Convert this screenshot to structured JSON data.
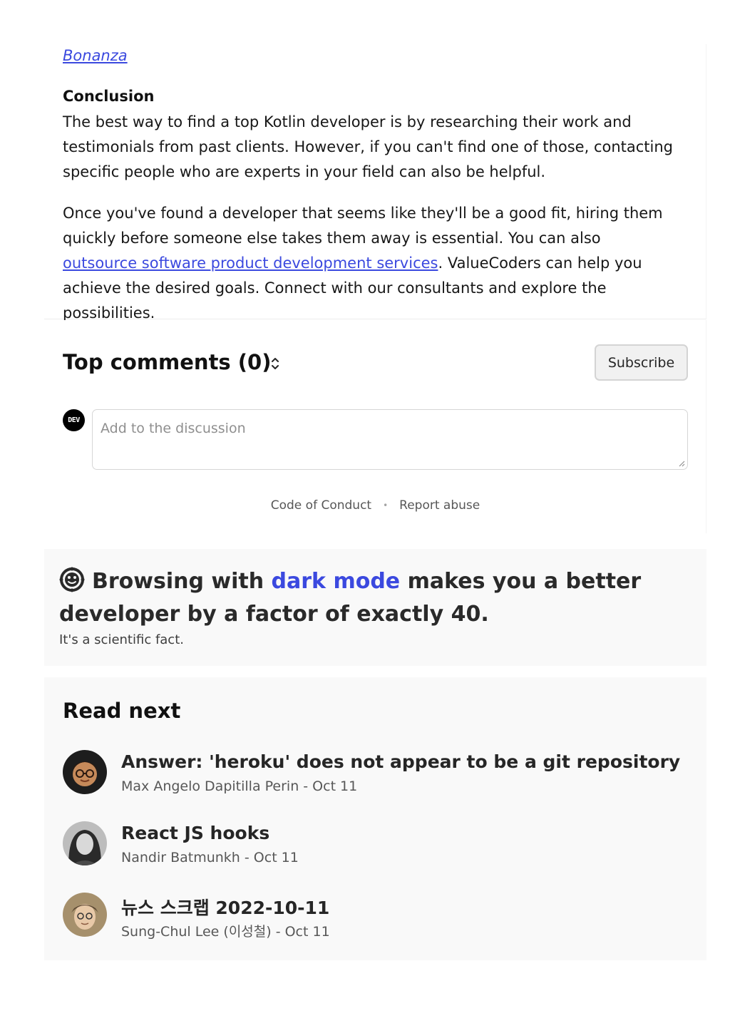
{
  "article": {
    "bonanza_link": "Bonanza",
    "conclusion_heading": "Conclusion",
    "paragraph1": "The best way to find a top Kotlin developer is by researching their work and testimonials from past clients. However, if you can't find one of those, contacting specific people who are experts in your field can also be helpful.",
    "paragraph2_before": "Once you've found a developer that seems like they'll be a good fit, hiring them quickly before someone else takes them away is essential. You can also ",
    "paragraph2_link": "outsource software product development services",
    "paragraph2_after": ". ValueCoders can help you achieve the desired goals. Connect with our consultants and explore the possibilities."
  },
  "comments": {
    "title": "Top comments (0)",
    "subscribe_label": "Subscribe",
    "avatar_text": "DEV",
    "input_placeholder": "Add to the discussion",
    "code_of_conduct": "Code of Conduct",
    "separator": "•",
    "report_abuse": "Report abuse"
  },
  "dark_mode": {
    "headline_before": "Browsing with ",
    "headline_accent": "dark mode",
    "headline_after": " makes you a better developer by a factor of exactly 40.",
    "subtext": "It's a scientific fact."
  },
  "read_next": {
    "title": "Read next",
    "items": [
      {
        "headline": "Answer: 'heroku' does not appear to be a git repository",
        "meta": "Max Angelo Dapitilla Perin - Oct 11"
      },
      {
        "headline": "React JS hooks",
        "meta": "Nandir Batmunkh - Oct 11"
      },
      {
        "headline": "뉴스 스크랩 2022-10-11",
        "meta": "Sung-Chul Lee (이성철) - Oct 11"
      }
    ]
  },
  "colors": {
    "link": "#3b49df",
    "text": "#171717",
    "muted": "#575757",
    "panel_bg": "#f9f9f9"
  }
}
